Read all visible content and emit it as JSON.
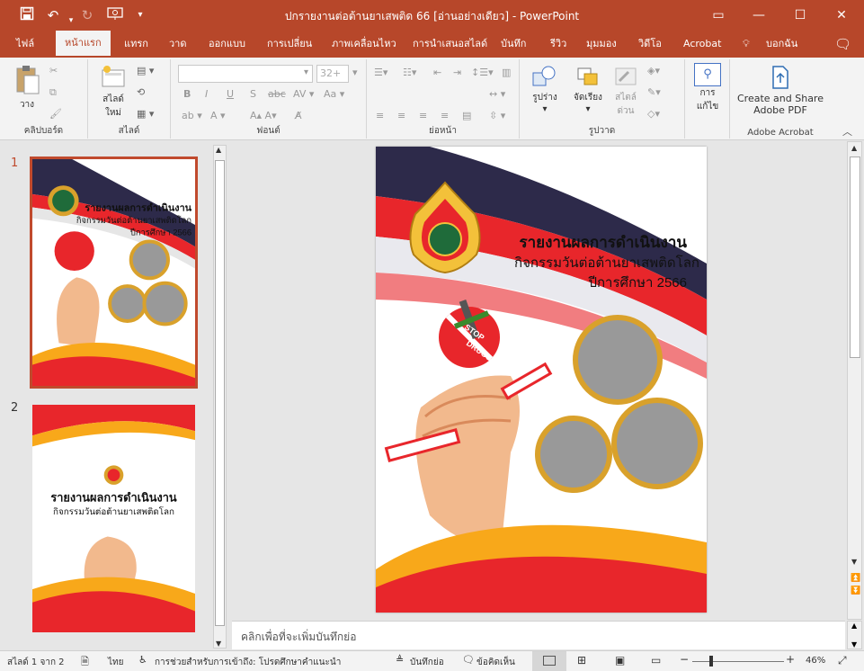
{
  "window": {
    "title": "ปกรายงานต่อต้านยาเสพติด 66 [อ่านอย่างเดียว]  -  PowerPoint",
    "title_bar_color": "#b7472a"
  },
  "quick_access": {
    "save_icon": "save-icon",
    "undo_icon": "undo-icon",
    "redo_icon": "redo-icon",
    "present_icon": "present-from-start-icon",
    "customize_icon": "customize-qat-icon"
  },
  "tabs": [
    "ไฟล์",
    "หน้าแรก",
    "แทรก",
    "วาด",
    "ออกแบบ",
    "การเปลี่ยน",
    "ภาพเคลื่อนไหว",
    "การนำเสนอสไลด์",
    "บันทึก",
    "รีวิว",
    "มุมมอง",
    "วิดีโอ",
    "Acrobat",
    "บอกฉัน"
  ],
  "ribbon": {
    "clipboard": {
      "paste": "วาง",
      "label": "คลิปบอร์ด"
    },
    "slides": {
      "new_slide_line1": "สไลด์",
      "new_slide_line2": "ใหม่",
      "label": "สไลด์"
    },
    "font": {
      "size": "32+",
      "label": "ฟอนต์"
    },
    "paragraph": {
      "label": "ย่อหน้า"
    },
    "drawing": {
      "shapes": "รูปร่าง",
      "arrange": "จัดเรียง",
      "quick_styles_line1": "สไตล์",
      "quick_styles_line2": "ด่วน",
      "label": "รูปวาด"
    },
    "editing": {
      "find_line1": "การ",
      "find_line2": "แก้ไข"
    },
    "acrobat": {
      "create_line1": "Create and Share",
      "create_line2": "Adobe PDF",
      "label": "Adobe Acrobat"
    }
  },
  "thumbnails": [
    {
      "number": "1",
      "selected": true
    },
    {
      "number": "2",
      "selected": false
    }
  ],
  "slide": {
    "title_line1": "รายงานผลการดำเนินงาน",
    "title_line2": "กิจกรรมวันต่อต้านยาเสพติดโลก",
    "title_line3": "ปีการศึกษา 2566",
    "badge_line1": "STOP",
    "badge_line2": "DRUGS"
  },
  "slide2": {
    "title_line1": "รายงานผลการดำเนินงาน",
    "title_line2": "กิจกรรมวันต่อต้านยาเสพติดโลก"
  },
  "notes_placeholder": "คลิกเพื่อที่จะเพิ่มบันทึกย่อ",
  "status": {
    "slide_counter": "สไลด์ 1 จาก 2",
    "language": "ไทย",
    "accessibility": "การช่วยสำหรับการเข้าถึง: โปรดศึกษาคำแนะนำ",
    "notes_btn": "บันทึกย่อ",
    "comments_btn": "ข้อคิดเห็น",
    "zoom": "46%"
  },
  "colors": {
    "accent": "#b7472a",
    "ribbon_bg": "#f3f3f3",
    "thai_red": "#e8262b",
    "thai_blue": "#2d2a4a",
    "gold": "#d9a12b"
  }
}
